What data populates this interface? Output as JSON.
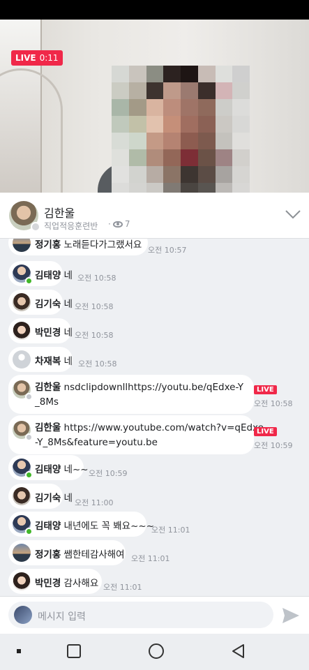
{
  "live": {
    "label": "LIVE",
    "time": "0:11"
  },
  "header": {
    "name": "김한울",
    "group": "직업적응훈련반",
    "views": "7"
  },
  "messages": [
    {
      "name": "정기홍",
      "text": "노래듣다가그랬서요",
      "time": "오전 10:57",
      "avatar": "sunset",
      "dot": "none"
    },
    {
      "name": "김태양",
      "text": "네",
      "time": "오전 10:58",
      "avatar": "grad",
      "dot": "green"
    },
    {
      "name": "김기숙",
      "text": "네",
      "time": "오전 10:58",
      "avatar": "woman",
      "dot": "none"
    },
    {
      "name": "박민경",
      "text": "네",
      "time": "오전 10:58",
      "avatar": "girl",
      "dot": "none"
    },
    {
      "name": "차재복",
      "text": "네",
      "time": "오전 10:58",
      "avatar": "blank",
      "dot": "none"
    },
    {
      "name": "김한울",
      "text": "nsdclipdownllhttps://youtu.be/qEdxe-Y",
      "text2": "_8Ms",
      "time": "오전 10:58",
      "avatar": "host",
      "dot": "grey",
      "live": "LIVE"
    },
    {
      "name": "김한울",
      "text": "https://www.youtube.com/watch?v=qEdxe",
      "text2": "-Y_8Ms&feature=youtu.be",
      "time": "오전 10:59",
      "avatar": "host",
      "dot": "grey",
      "live": "LIVE"
    },
    {
      "name": "김태양",
      "text": "네~~",
      "time": "오전 10:59",
      "avatar": "grad",
      "dot": "green"
    },
    {
      "name": "김기숙",
      "text": "네",
      "time": "오전 11:00",
      "avatar": "woman",
      "dot": "none"
    },
    {
      "name": "김태양",
      "text": "내년에도 꼭 봬요~~~",
      "time": "오전 11:01",
      "avatar": "grad",
      "dot": "green"
    },
    {
      "name": "정기홍",
      "text": "쌤한테감사해여",
      "time": "오전 11:01",
      "avatar": "sunset",
      "dot": "none"
    },
    {
      "name": "박민경",
      "text": "감사해요",
      "time": "오전 11:01",
      "avatar": "girl",
      "dot": "none"
    }
  ],
  "composer": {
    "placeholder": "메시지 입력"
  },
  "icons": {
    "views": "eye-icon",
    "collapse": "chevron-down-icon",
    "send": "send-icon",
    "back": "back-icon",
    "home": "home-icon",
    "recents": "recents-icon"
  }
}
